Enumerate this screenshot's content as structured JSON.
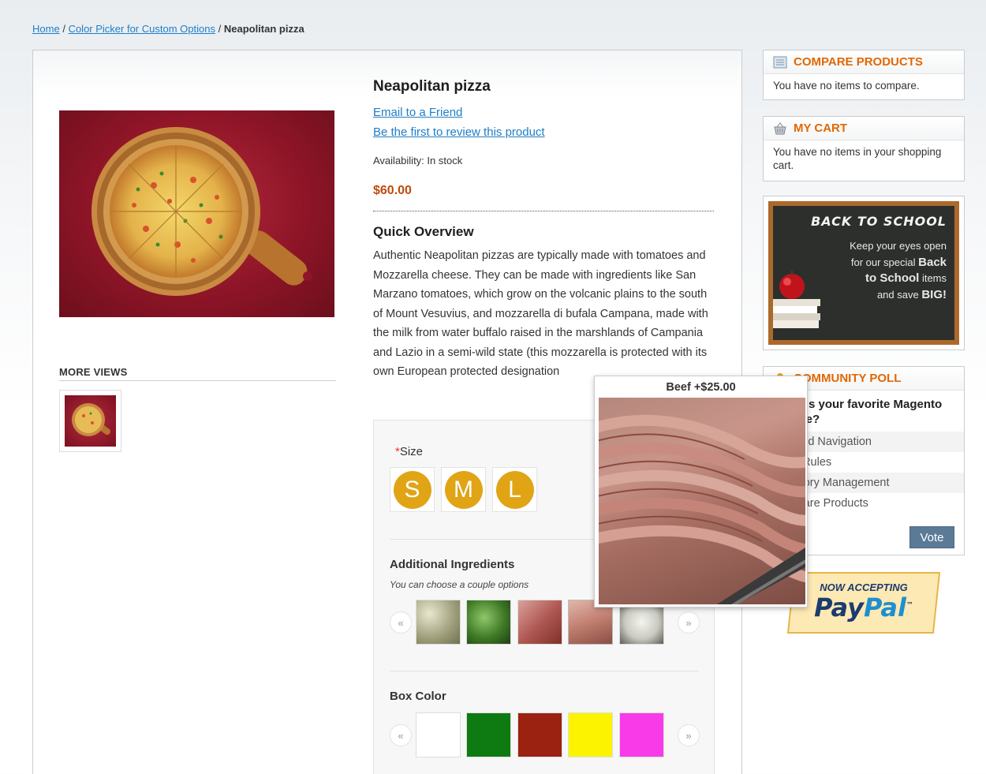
{
  "breadcrumb": {
    "home": "Home",
    "separator": "/",
    "category": "Color Picker for Custom Options",
    "current": "Neapolitan pizza"
  },
  "product": {
    "name": "Neapolitan pizza",
    "email_link": "Email to a Friend",
    "review_link": "Be the first to review this product",
    "availability_label": "Availability:",
    "availability_value": "In stock",
    "price": "$60.00",
    "overview_title": "Quick Overview",
    "overview_text": "Authentic Neapolitan pizzas are typically made with tomatoes and Mozzarella cheese. They can be made with ingredients like San Marzano tomatoes, which grow on the volcanic plains to the south of Mount Vesuvius, and mozzarella di bufala Campana, made with the milk from water buffalo raised in the marshlands of Campania and Lazio in a semi-wild state (this mozzarella is protected with its own European protected designation"
  },
  "more_views": {
    "title": "MORE VIEWS"
  },
  "options": {
    "size": {
      "required_mark": "*",
      "label": "Size",
      "choices": [
        "S",
        "M",
        "L"
      ]
    },
    "ingredients": {
      "title": "Additional Ingredients",
      "note": "You can choose a couple options",
      "prev": "«",
      "next": "»"
    },
    "box_color": {
      "title": "Box Color",
      "prev": "«",
      "next": "»",
      "colors": [
        "#ffffff",
        "#0d7a12",
        "#9b2110",
        "#fbf300",
        "#f93ae8"
      ]
    }
  },
  "popup": {
    "caption": "Beef +$25.00"
  },
  "sidebar": {
    "compare": {
      "title": "COMPARE PRODUCTS",
      "text": "You have no items to compare."
    },
    "cart": {
      "title": "MY CART",
      "text": "You have no items in your shopping cart."
    },
    "back_to_school": {
      "title": "BACK TO SCHOOL",
      "line1": "Keep your eyes open",
      "line2_pre": "for our special ",
      "line2_bold": "Back",
      "line3_bold": "to School",
      "line3_post": " items",
      "line4_pre": "and save ",
      "line4_bold": "BIG!"
    },
    "poll": {
      "title": "COMMUNITY POLL",
      "question": "What is your favorite Magento feature?",
      "options": [
        "Layered Navigation",
        "Price Rules",
        "Category Management",
        "Compare Products"
      ],
      "vote_label": "Vote"
    },
    "paypal": {
      "now_accepting": "NOW ACCEPTING",
      "logo_pay": "Pay",
      "logo_pal": "Pal",
      "tm": "™"
    }
  },
  "colors": {
    "accent_orange": "#e26703",
    "link_blue": "#1e7ec8",
    "price": "#c04a0c",
    "size_swatch": "#e0a415",
    "vote_button": "#5b7a96"
  }
}
